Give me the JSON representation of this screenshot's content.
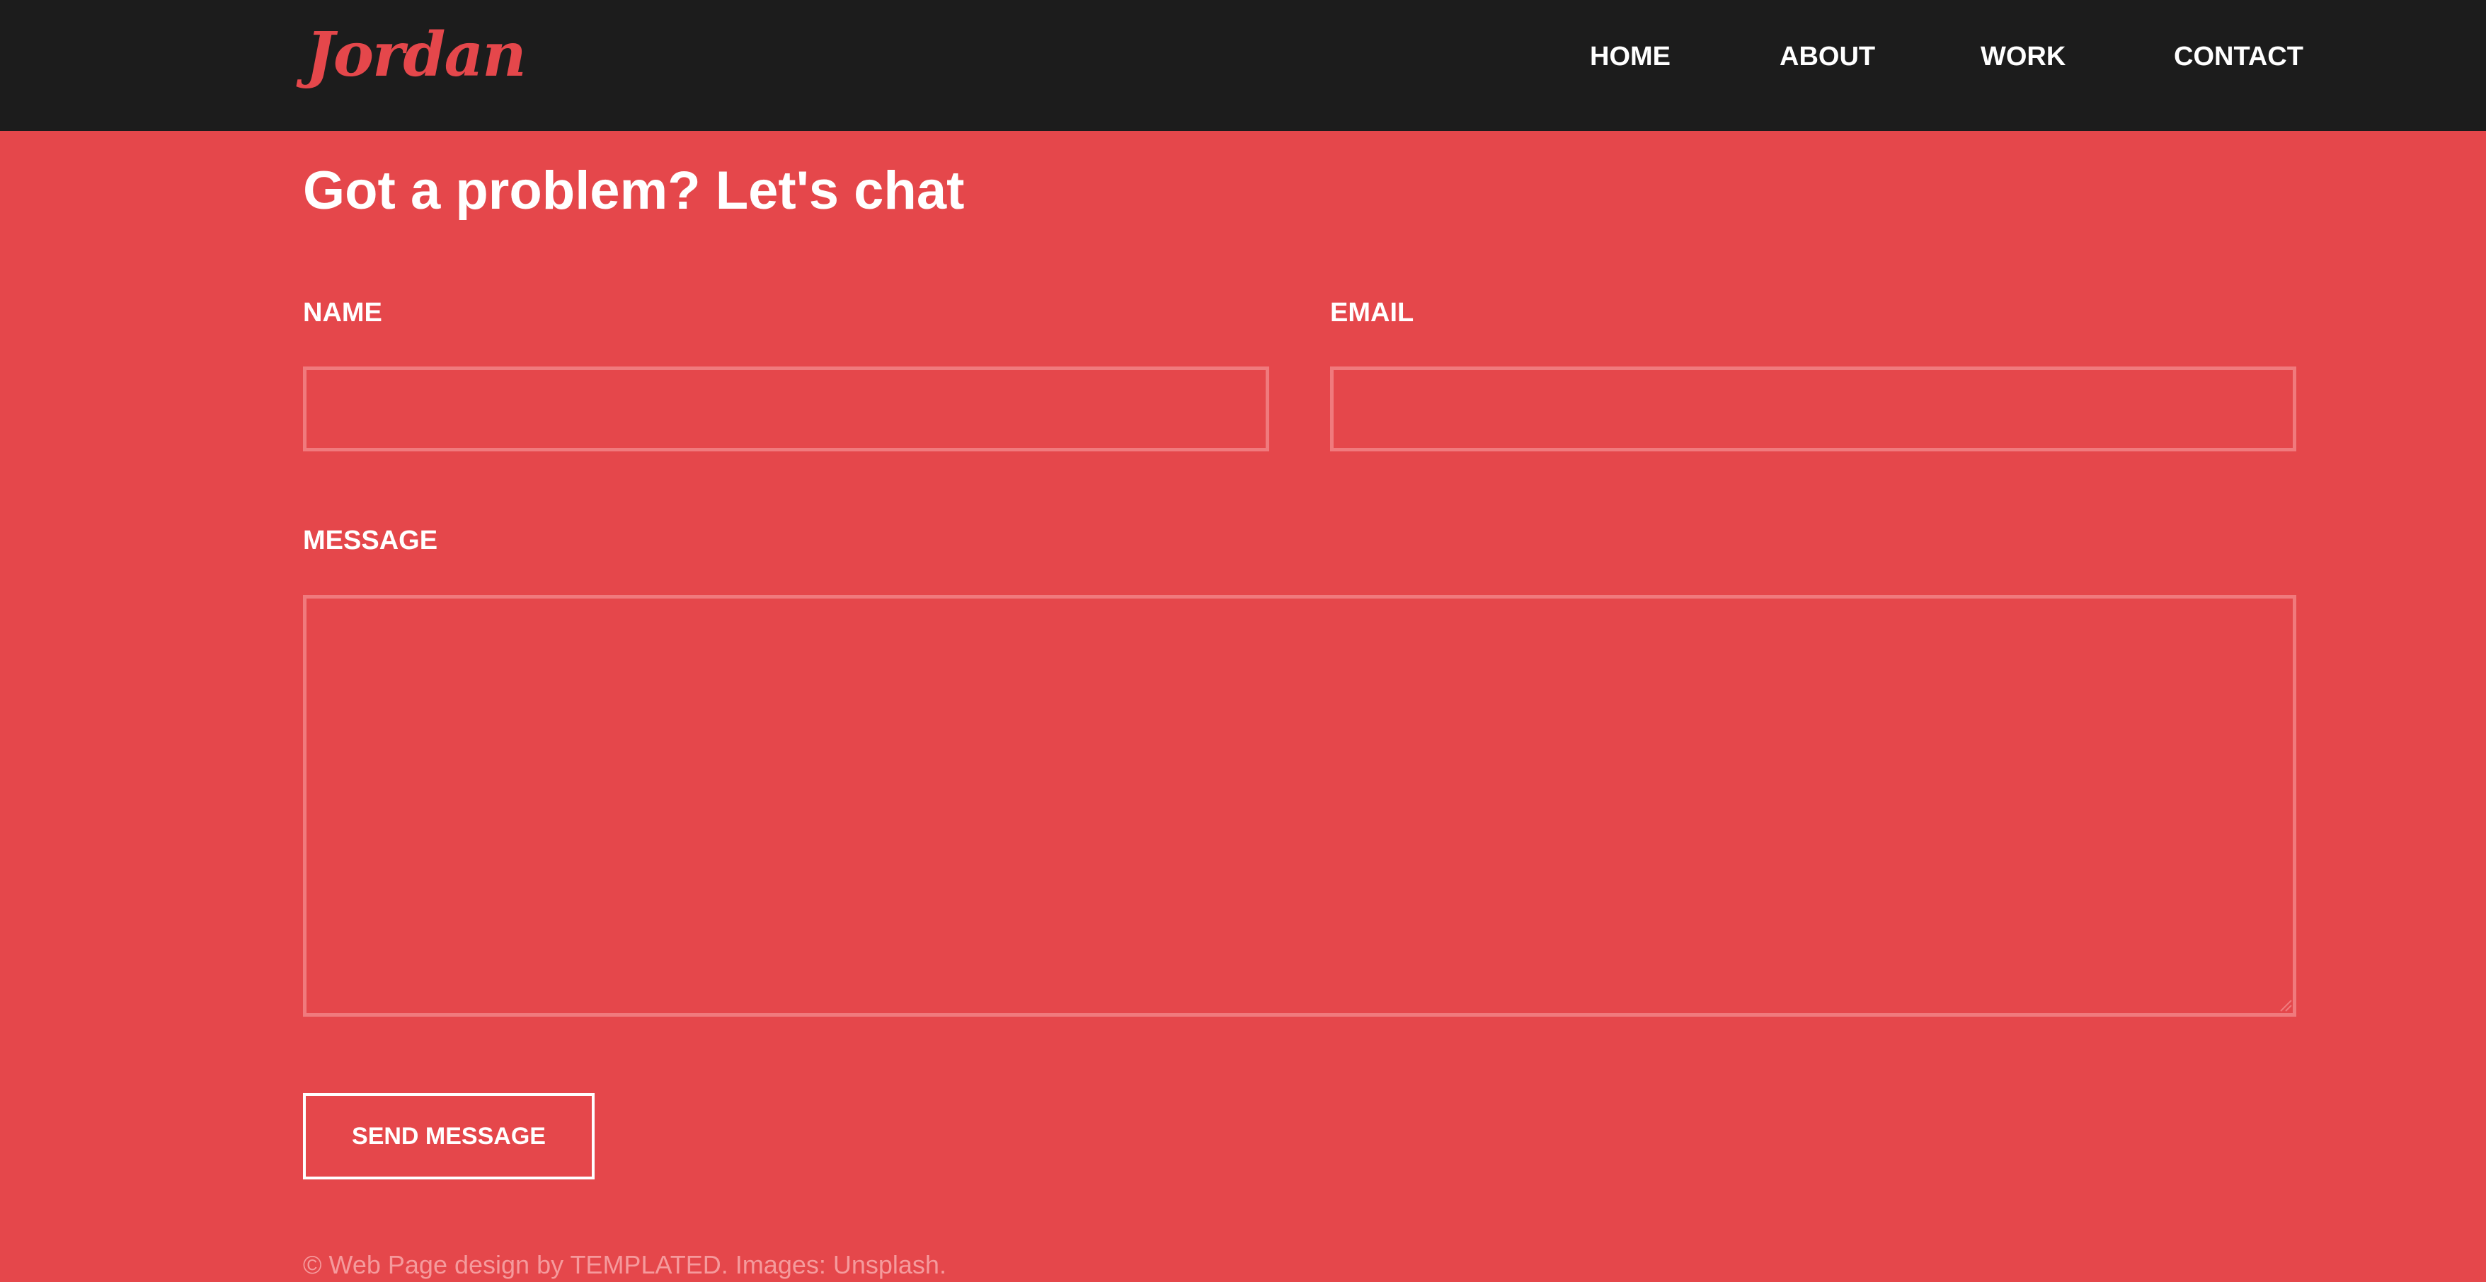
{
  "header": {
    "logo": "Jordan",
    "nav": {
      "home": "HOME",
      "about": "ABOUT",
      "work": "WORK",
      "contact": "CONTACT"
    }
  },
  "contact": {
    "heading": "Got a problem? Let's chat",
    "form": {
      "name_label": "NAME",
      "name_value": "",
      "email_label": "EMAIL",
      "email_value": "",
      "message_label": "MESSAGE",
      "message_value": "",
      "submit_label": "SEND MESSAGE"
    }
  },
  "footer": {
    "text": "© Web Page design by TEMPLATED. Images: Unsplash."
  },
  "colors": {
    "background": "#e5474b",
    "header_bar": "#1c1c1c",
    "field_border": "#f07a7d",
    "text": "#ffffff"
  }
}
